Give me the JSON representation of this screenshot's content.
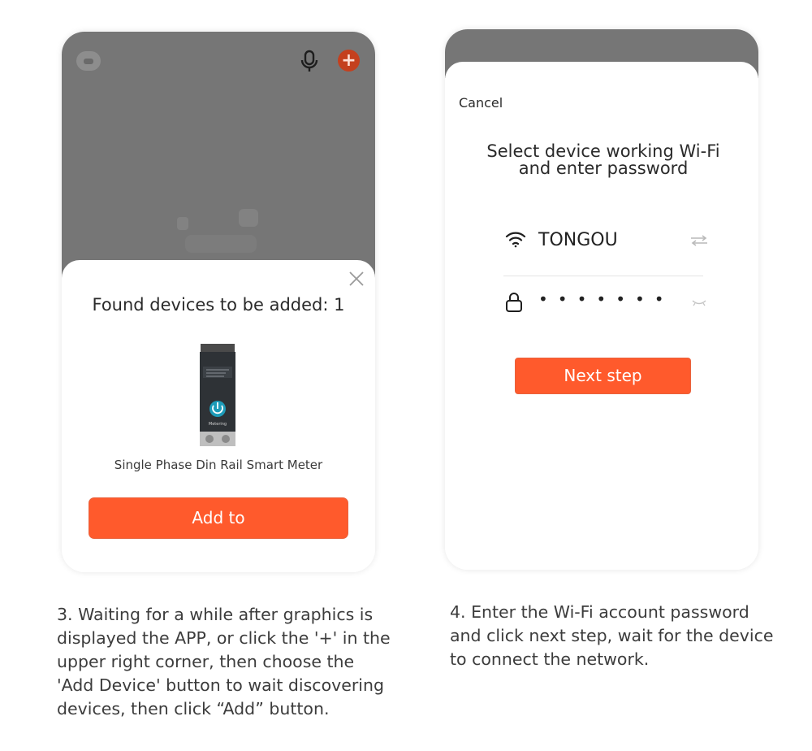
{
  "left_phone": {
    "found_title": "Found devices to be added: 1",
    "device_name": "Single Phase Din Rail Smart Meter",
    "device_label": "Metering",
    "add_button": "Add to"
  },
  "right_phone": {
    "cancel": "Cancel",
    "title_line1": "Select device working Wi-Fi",
    "title_line2": "and enter password",
    "ssid": "TONGOU",
    "password_mask": "•••••••",
    "next_button": "Next step"
  },
  "captions": {
    "left": [
      "3. Waiting for a while after graphics is",
      "displayed the APP, or click the '+' in the",
      "upper right corner, then choose the",
      "'Add Device' button to wait discovering",
      "devices, then click “Add” button."
    ],
    "right": [
      "4. Enter the Wi-Fi account password",
      "and click next step, wait for the device",
      "to connect the network."
    ]
  },
  "colors": {
    "accent": "#ff5a2c",
    "overlay_gray": "#767676"
  },
  "icons": [
    "app-icon",
    "mic-icon",
    "plus-icon",
    "close-icon",
    "wifi-icon",
    "switch-network-icon",
    "lock-icon",
    "eye-closed-icon"
  ]
}
